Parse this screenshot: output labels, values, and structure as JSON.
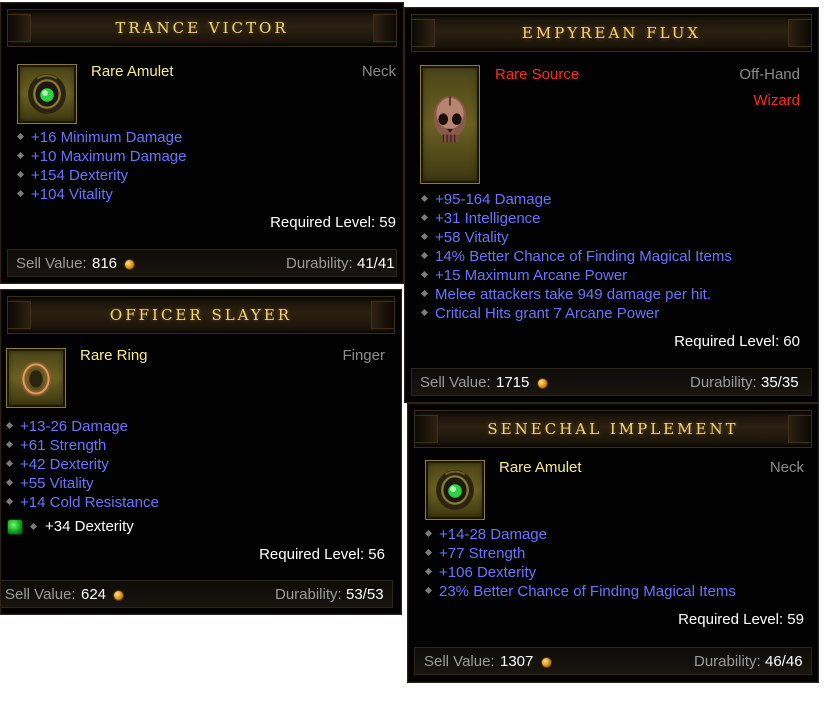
{
  "items": {
    "trance_victor": {
      "name": "TRANCE VICTOR",
      "type": "Rare Amulet",
      "slot": "Neck",
      "affixes": [
        "+16 Minimum Damage",
        "+10 Maximum Damage",
        "+154 Dexterity",
        "+104 Vitality"
      ],
      "required_level": "Required Level: 59",
      "sell_label": "Sell Value:",
      "sell_value": "816",
      "durability_label": "Durability:",
      "durability_value": "41/41"
    },
    "empyrean_flux": {
      "name": "EMPYREAN FLUX",
      "type": "Rare Source",
      "slot": "Off-Hand",
      "class": "Wizard",
      "affixes": [
        "+95-164 Damage",
        "+31 Intelligence",
        "+58 Vitality",
        "14% Better Chance of Finding Magical Items",
        "+15 Maximum Arcane Power",
        "Melee attackers take 949 damage per hit.",
        "Critical Hits grant 7 Arcane Power"
      ],
      "required_level": "Required Level: 60",
      "sell_label": "Sell Value:",
      "sell_value": "1715",
      "durability_label": "Durability:",
      "durability_value": "35/35"
    },
    "officer_slayer": {
      "name": "OFFICER SLAYER",
      "type": "Rare Ring",
      "slot": "Finger",
      "affixes": [
        "+13-26 Damage",
        "+61 Strength",
        "+42 Dexterity",
        "+55 Vitality",
        "+14 Cold Resistance"
      ],
      "socket_bonus": "+34 Dexterity",
      "required_level": "Required Level: 56",
      "sell_label": "Sell Value:",
      "sell_value": "624",
      "durability_label": "Durability:",
      "durability_value": "53/53"
    },
    "senechal_implement": {
      "name": "SENECHAL IMPLEMENT",
      "type": "Rare Amulet",
      "slot": "Neck",
      "affixes": [
        "+14-28 Damage",
        "+77 Strength",
        "+106 Dexterity",
        "23% Better Chance of Finding Magical Items"
      ],
      "required_level": "Required Level: 59",
      "sell_label": "Sell Value:",
      "sell_value": "1307",
      "durability_label": "Durability:",
      "durability_value": "46/46"
    }
  },
  "icons": {
    "amulet": "amulet-icon",
    "source": "skull-source-icon",
    "ring": "ring-icon",
    "socket": "emerald-gem-icon",
    "gold": "gold-coin-icon"
  },
  "colors": {
    "title_gold": "#f5d57c",
    "rare_yellow": "#f8ea8f",
    "affix_blue": "#6c72ff",
    "class_red": "#ff2a1a",
    "slot_gray": "#8c8c8c"
  }
}
